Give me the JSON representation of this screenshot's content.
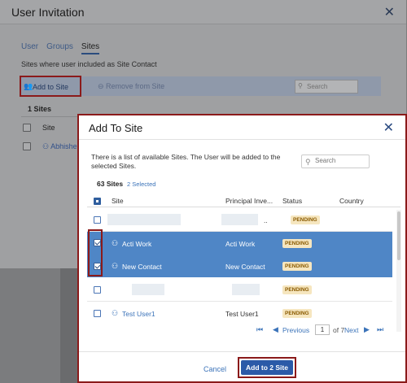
{
  "bg": {
    "title": "User Invitation",
    "close": "✕",
    "tabs": [
      "User",
      "Groups",
      "Sites"
    ],
    "description": "Sites where user included as Site Contact",
    "add_label": "Add to Site",
    "remove_label": "Remove from Site",
    "search_placeholder": "Search",
    "count": "1 Sites",
    "col_site": "Site",
    "user_row": "Abhishe"
  },
  "modal": {
    "title": "Add To Site",
    "close": "✕",
    "description": "There is a list of available Sites. The User will be added to the selected Sites.",
    "search_placeholder": "Search",
    "count": "63 Sites",
    "selected": "2 Selected",
    "columns": {
      "site": "Site",
      "principal": "Principal Inve...",
      "status": "Status",
      "country": "Country"
    },
    "rows": [
      {
        "site": "",
        "principal": "..",
        "status": "PENDING",
        "selected": false
      },
      {
        "site": "Acti Work",
        "principal": "Acti Work",
        "status": "PENDING",
        "selected": true
      },
      {
        "site": "New Contact",
        "principal": "New Contact",
        "status": "PENDING",
        "selected": true
      },
      {
        "site": "",
        "principal": "",
        "status": "PENDING",
        "selected": false
      },
      {
        "site": "Test User1",
        "principal": "Test User1",
        "status": "PENDING",
        "selected": false
      }
    ],
    "pager": {
      "previous": "Previous",
      "page": "1",
      "of": "of 7",
      "next": "Next"
    },
    "cancel": "Cancel",
    "submit": "Add to 2 Site"
  },
  "colors": {
    "accent": "#2b5aa8",
    "selected_row": "#4f86c6",
    "highlight": "#8b1a1a",
    "badge_bg": "#f6e6bf"
  }
}
